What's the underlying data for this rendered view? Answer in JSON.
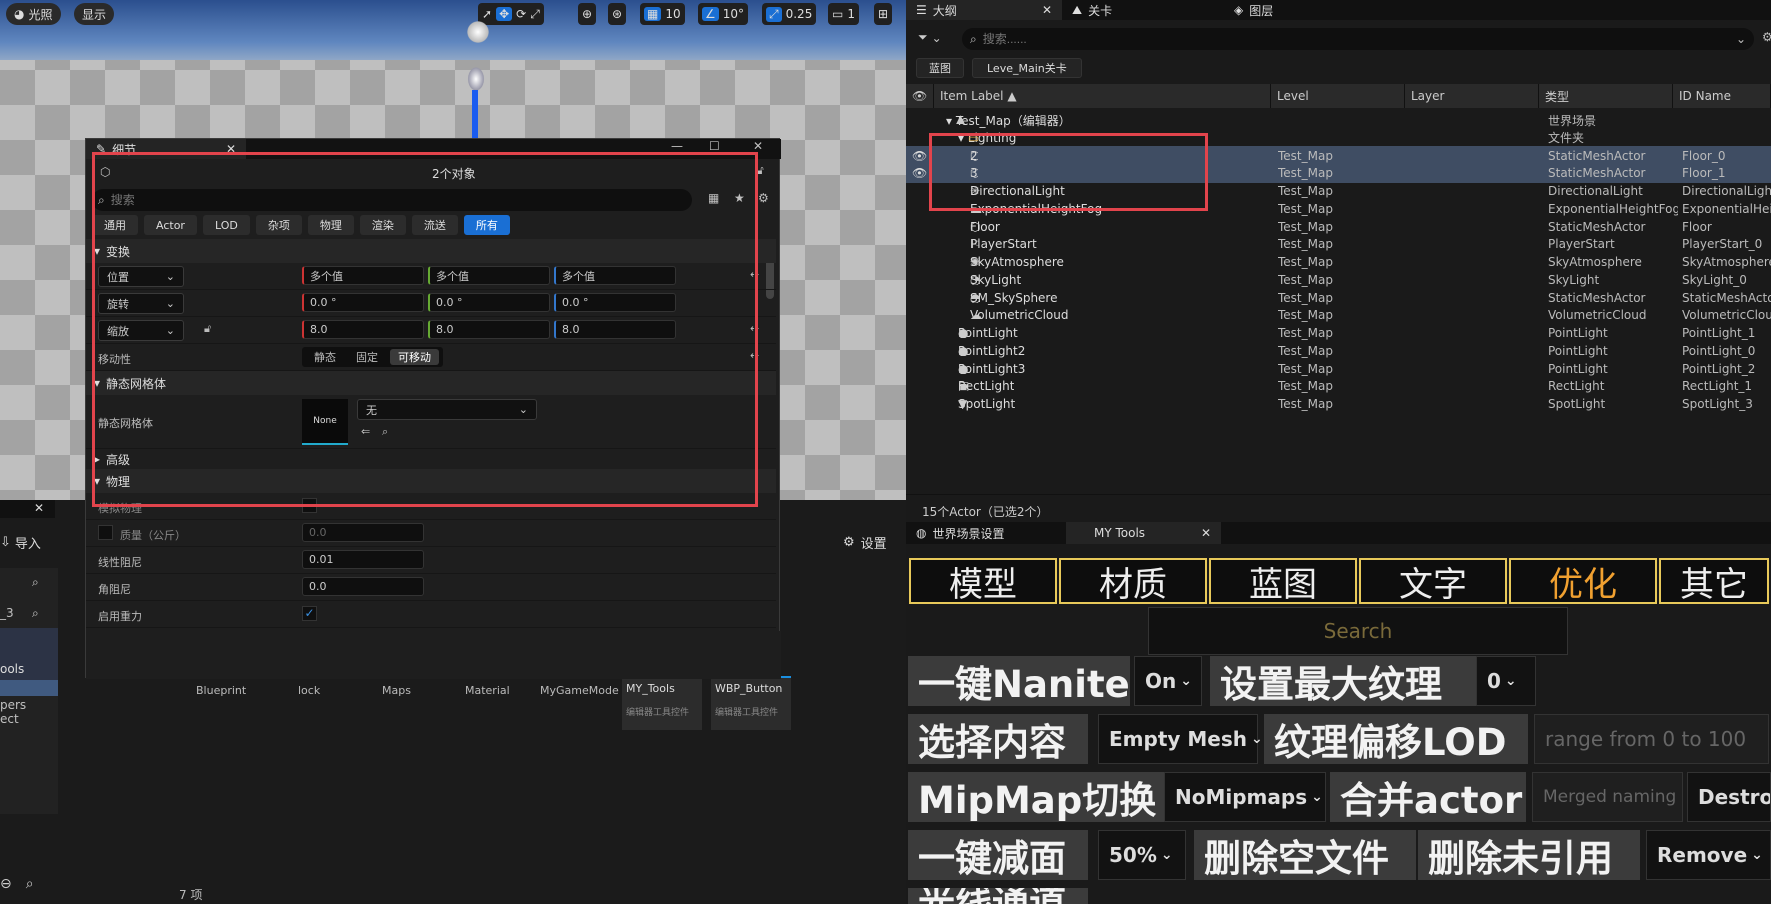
{
  "viewport": {
    "lighting_btn": "光照",
    "show_btn": "显示",
    "grid_size": "10",
    "rotate_snap": "10°",
    "scale_snap": "0.25",
    "camera_speed": "1"
  },
  "outliner": {
    "tabs": [
      {
        "label": "大纲"
      },
      {
        "label": "关卡"
      },
      {
        "label": "图层"
      }
    ],
    "search_placeholder": "搜索......",
    "filter_chips": [
      "蓝图",
      "Leve_Main关卡"
    ],
    "columns": [
      "Item Label ▲",
      "Level",
      "Layer",
      "类型",
      "ID Name"
    ],
    "rows": [
      {
        "label": "Test_Map（编辑器）",
        "level": "",
        "type": "世界场景",
        "id": ""
      },
      {
        "label": "Lighting",
        "level": "",
        "type": "文件夹",
        "id": ""
      },
      {
        "label": "2",
        "level": "Test_Map",
        "type": "StaticMeshActor",
        "id": "Floor_0"
      },
      {
        "label": "3",
        "level": "Test_Map",
        "type": "StaticMeshActor",
        "id": "Floor_1"
      },
      {
        "label": "DirectionalLight",
        "level": "Test_Map",
        "type": "DirectionalLight",
        "id": "DirectionalLight"
      },
      {
        "label": "ExponentialHeightFog",
        "level": "Test_Map",
        "type": "ExponentialHeightFog",
        "id": "ExponentialHeig"
      },
      {
        "label": "Floor",
        "level": "Test_Map",
        "type": "StaticMeshActor",
        "id": "Floor"
      },
      {
        "label": "PlayerStart",
        "level": "Test_Map",
        "type": "PlayerStart",
        "id": "PlayerStart_0"
      },
      {
        "label": "SkyAtmosphere",
        "level": "Test_Map",
        "type": "SkyAtmosphere",
        "id": "SkyAtmosphere"
      },
      {
        "label": "SkyLight",
        "level": "Test_Map",
        "type": "SkyLight",
        "id": "SkyLight_0"
      },
      {
        "label": "SM_SkySphere",
        "level": "Test_Map",
        "type": "StaticMeshActor",
        "id": "StaticMeshActo"
      },
      {
        "label": "VolumetricCloud",
        "level": "Test_Map",
        "type": "VolumetricCloud",
        "id": "VolumetricClou"
      },
      {
        "label": "PointLight",
        "level": "Test_Map",
        "type": "PointLight",
        "id": "PointLight_1"
      },
      {
        "label": "PointLight2",
        "level": "Test_Map",
        "type": "PointLight",
        "id": "PointLight_0"
      },
      {
        "label": "PointLight3",
        "level": "Test_Map",
        "type": "PointLight",
        "id": "PointLight_2"
      },
      {
        "label": "RectLight",
        "level": "Test_Map",
        "type": "RectLight",
        "id": "RectLight_1"
      },
      {
        "label": "SpotLight",
        "level": "Test_Map",
        "type": "SpotLight",
        "id": "SpotLight_3"
      }
    ],
    "status": "15个Actor（已选2个）"
  },
  "details": {
    "tab_label": "细节",
    "object_count": "2个对象",
    "search_placeholder": "搜索",
    "categories": [
      "通用",
      "Actor",
      "LOD",
      "杂项",
      "物理",
      "渲染",
      "流送",
      "所有"
    ],
    "transform_section": "变换",
    "location_label": "位置",
    "rotation_label": "旋转",
    "scale_label": "缩放",
    "multi_value": "多个值",
    "rot_values": [
      "0.0 °",
      "0.0 °",
      "0.0 °"
    ],
    "scale_values": [
      "8.0",
      "8.0",
      "8.0"
    ],
    "mobility_label": "移动性",
    "mobility_options": [
      "静态",
      "固定",
      "可移动"
    ],
    "static_mesh_section": "静态网格体",
    "static_mesh_label": "静态网格体",
    "mesh_thumb": "None",
    "mesh_value": "无",
    "advanced": "高级",
    "physics_section": "物理",
    "simulate_physics": "模拟物理",
    "mass_label": "质量（公斤）",
    "mass_value": "0.0",
    "linear_damping_label": "线性阻尼",
    "linear_damping": "0.01",
    "angular_damping_label": "角阻尼",
    "angular_damping": "0.0",
    "gravity_label": "启用重力"
  },
  "content": {
    "import": "导入",
    "settings": "设置",
    "folders": [
      "Blueprint",
      "lock",
      "Maps",
      "Material",
      "MyGameMode"
    ],
    "assets": [
      {
        "name": "MY_Tools",
        "sub": "编辑器工具控件"
      },
      {
        "name": "WBP_Button",
        "sub": "编辑器工具控件"
      }
    ],
    "left_items": [
      "_3",
      "ools",
      "pers",
      "ect"
    ],
    "item_count": "7 项"
  },
  "tools": {
    "tabs": [
      {
        "label": "世界场景设置"
      },
      {
        "label": "MY Tools"
      }
    ],
    "categories": [
      "模型",
      "材质",
      "蓝图",
      "文字",
      "优化",
      "其它"
    ],
    "search_placeholder": "Search",
    "nanite_btn": "一键Nanite",
    "nanite_opt": "On",
    "max_tex_btn": "设置最大纹理",
    "max_tex_opt": "0",
    "select_btn": "选择内容",
    "select_opt": "Empty Mesh",
    "lod_btn": "纹理偏移LOD",
    "lod_input": "range from 0 to 100",
    "mipmap_btn": "MipMap切换",
    "mipmap_opt": "NoMipmaps",
    "merge_btn": "合并actor",
    "merge_input": "Merged naming",
    "destroy_opt": "Destroy",
    "reduce_btn": "一键减面",
    "reduce_opt": "50%",
    "del_empty_btn": "删除空文件",
    "del_unref_btn": "删除未引用",
    "remove_opt": "Remove",
    "lightchan_btn": "光线通道"
  },
  "colors": {
    "accent": "#1a6fd4",
    "highlight": "#e2444c",
    "tab_border": "#e8c95a",
    "optimize": "#f0a030"
  }
}
